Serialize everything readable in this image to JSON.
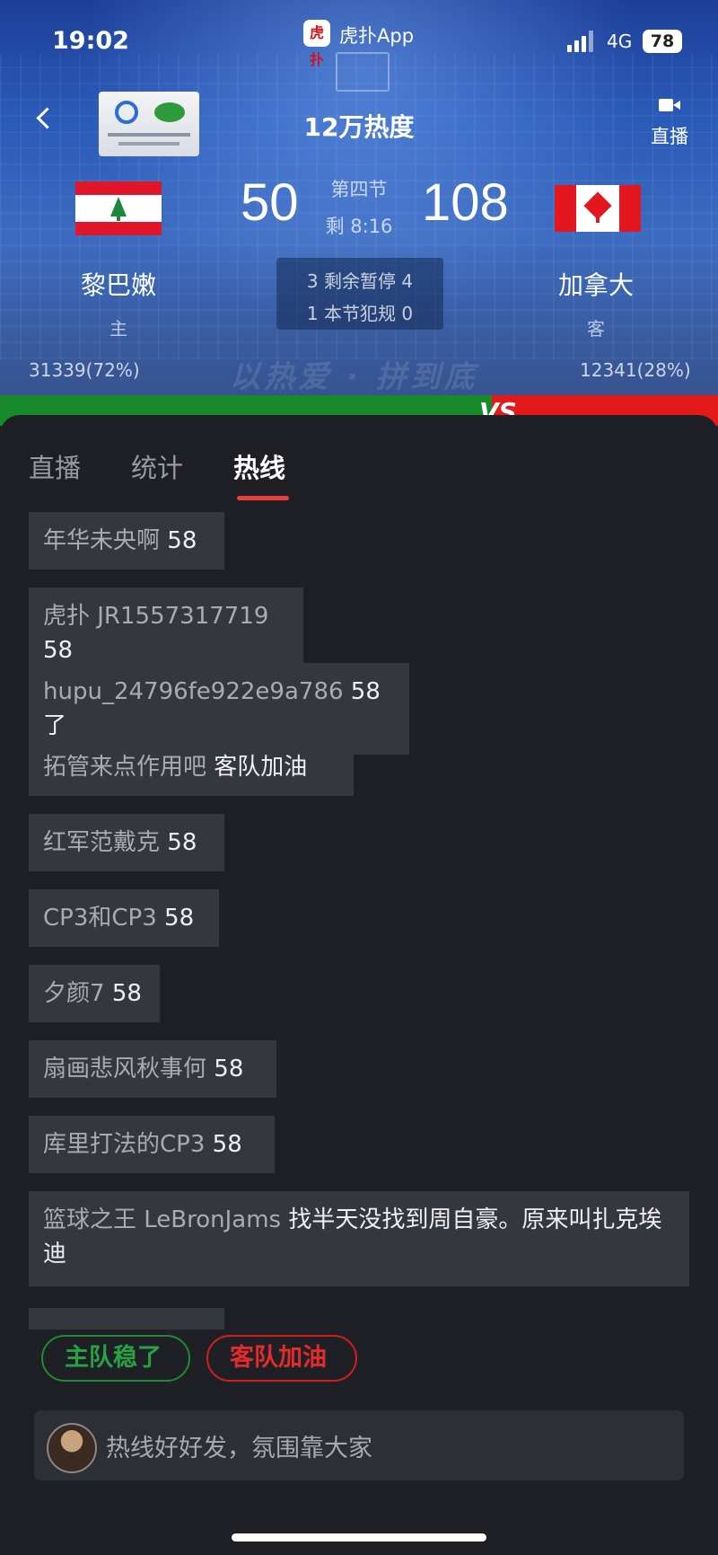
{
  "status_bar": {
    "time": "19:02",
    "app_name": "虎扑App",
    "app_badge": "虎扑",
    "network": "4G",
    "battery": "78"
  },
  "header": {
    "title": "12万热度",
    "live_label": "直播"
  },
  "game": {
    "home": {
      "name": "黎巴嫩",
      "role": "主",
      "score": "50",
      "support": "31339(72%)",
      "color": "#178a2a"
    },
    "away": {
      "name": "加拿大",
      "role": "客",
      "score": "108",
      "support": "12341(28%)",
      "color": "#e41a1a"
    },
    "period": "第四节",
    "clock": "剩 8:16",
    "timeouts": "3 剩余暂停 4",
    "fouls": "1 本节犯规 0",
    "vs": "VS",
    "slogan": "以热爱 · 拼到底"
  },
  "tabs": [
    {
      "label": "直播"
    },
    {
      "label": "统计"
    },
    {
      "label": "热线",
      "active": true
    }
  ],
  "messages": [
    {
      "user": "年华未央啊",
      "text": "58"
    },
    {
      "user": "虎扑 JR1557317719",
      "text": "58"
    },
    {
      "user": "hupu_24796fe922e9a786",
      "text": "58了"
    },
    {
      "user": "拓管来点作用吧",
      "text": "客队加油"
    },
    {
      "user": "红军范戴克",
      "text": "58"
    },
    {
      "user": "CP3和CP3",
      "text": "58"
    },
    {
      "user": "夕颜7",
      "text": "58"
    },
    {
      "user": "扇画悲风秋事何",
      "text": "58"
    },
    {
      "user": "库里打法的CP3",
      "text": "58"
    },
    {
      "user": "篮球之王 LeBronJams",
      "text": "找半天没找到周自豪。原来叫扎克埃迪"
    }
  ],
  "quick_replies": {
    "home": "主队稳了",
    "away": "客队加油"
  },
  "input": {
    "placeholder": "热线好好发，氛围靠大家"
  },
  "colors": {
    "accent": "#e8413a",
    "bubble": "#35373e",
    "background": "#1f2025"
  }
}
